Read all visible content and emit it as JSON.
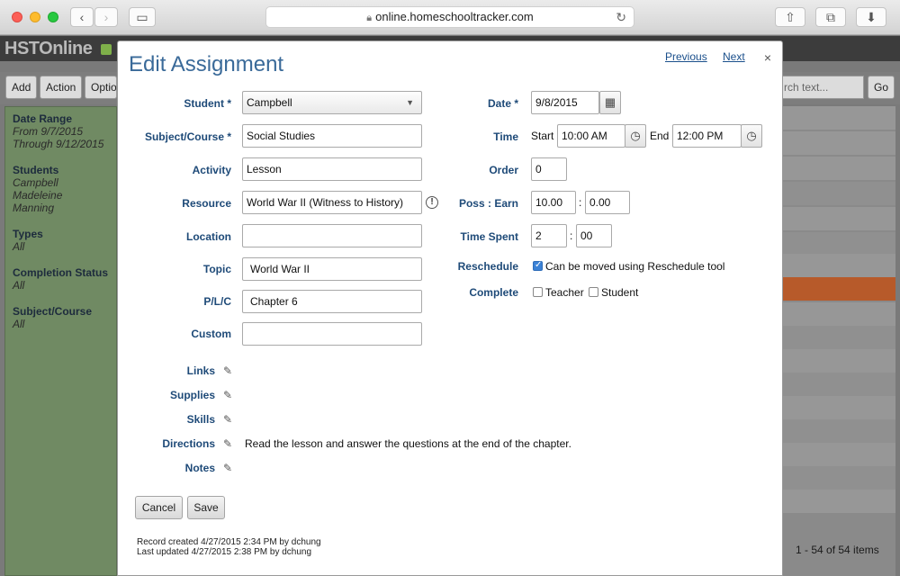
{
  "browser": {
    "url": "online.homeschooltracker.com"
  },
  "app": {
    "logo": "HSTOnline",
    "toolbar": {
      "add": "Add",
      "action": "Action",
      "options": "Optio"
    },
    "search_placeholder": "rch text...",
    "go": "Go",
    "pager": "1 - 54 of 54 items",
    "sidebar": {
      "date_range_label": "Date Range",
      "date_from": "From 9/7/2015",
      "date_through": "Through 9/12/2015",
      "students_label": "Students",
      "students": [
        "Campbell",
        "Madeleine",
        "Manning"
      ],
      "types_label": "Types",
      "types_value": "All",
      "completion_label": "Completion Status",
      "completion_value": "All",
      "subject_label": "Subject/Course",
      "subject_value": "All"
    }
  },
  "modal": {
    "title": "Edit Assignment",
    "previous": "Previous",
    "next": "Next",
    "close": "×",
    "labels": {
      "student": "Student *",
      "subject": "Subject/Course *",
      "activity": "Activity",
      "resource": "Resource",
      "location": "Location",
      "topic": "Topic",
      "plc": "P/L/C",
      "custom": "Custom",
      "date": "Date *",
      "time": "Time",
      "order": "Order",
      "poss_earn": "Poss : Earn",
      "time_spent": "Time Spent",
      "reschedule": "Reschedule",
      "complete": "Complete",
      "links": "Links",
      "supplies": "Supplies",
      "skills": "Skills",
      "directions": "Directions",
      "notes": "Notes",
      "start": "Start",
      "end": "End"
    },
    "values": {
      "student": "Campbell",
      "subject": "Social Studies",
      "activity": "Lesson",
      "resource": "World War II (Witness to History)",
      "location": "",
      "topic": "World War II",
      "plc": "Chapter 6",
      "custom": "",
      "date": "9/8/2015",
      "start_time": "10:00 AM",
      "end_time": "12:00 PM",
      "order": "0",
      "poss": "10.00",
      "earn": "0.00",
      "time_spent_hours": "2",
      "time_spent_minutes": "00",
      "reschedule_text": "Can be moved using Reschedule tool",
      "reschedule_checked": true,
      "complete_teacher": "Teacher",
      "complete_student": "Student",
      "directions_text": "Read the lesson and answer the questions at the end of the chapter.",
      "colon": ":"
    },
    "buttons": {
      "cancel": "Cancel",
      "save": "Save"
    },
    "footer": {
      "created": "Record created 4/27/2015 2:34 PM by dchung",
      "updated": "Last updated 4/27/2015 2:38 PM by dchung"
    }
  }
}
